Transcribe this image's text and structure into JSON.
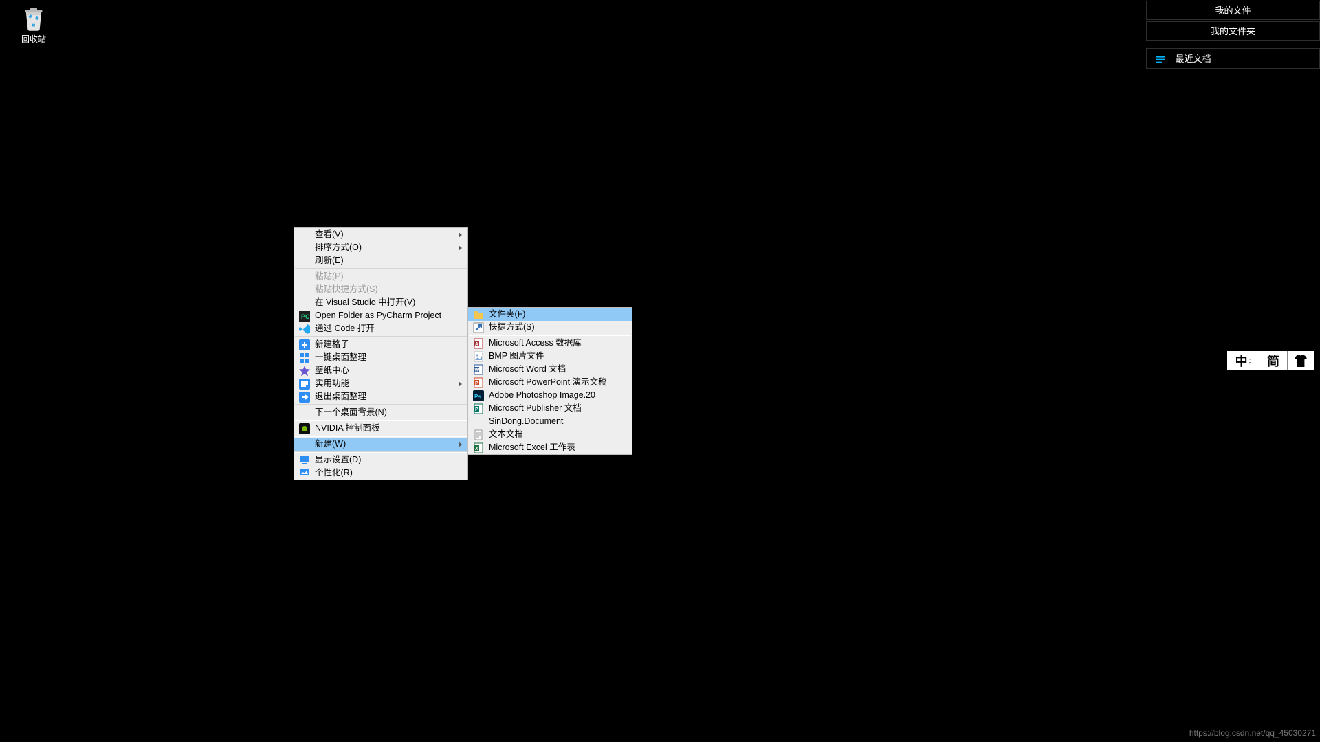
{
  "desktop": {
    "recycle_bin_label": "回收站"
  },
  "side": {
    "my_files": "我的文件",
    "my_folder": "我的文件夹",
    "recent_docs": "最近文档"
  },
  "ctx": {
    "view": "查看(V)",
    "sort": "排序方式(O)",
    "refresh": "刷新(E)",
    "paste": "粘贴(P)",
    "paste_shortcut": "粘贴快捷方式(S)",
    "open_vs": "在 Visual Studio 中打开(V)",
    "open_pycharm": "Open Folder as PyCharm Project",
    "open_code": "通过 Code 打开",
    "new_grid": "新建格子",
    "one_click_arrange": "一键桌面整理",
    "wallpaper_center": "壁纸中心",
    "utility": "实用功能",
    "exit_arrange": "退出桌面整理",
    "next_wallpaper": "下一个桌面背景(N)",
    "nvidia_cp": "NVIDIA 控制面板",
    "new": "新建(W)",
    "display_settings": "显示设置(D)",
    "personalize": "个性化(R)"
  },
  "newmenu": {
    "folder": "文件夹(F)",
    "shortcut": "快捷方式(S)",
    "access": "Microsoft Access 数据库",
    "bmp": "BMP 图片文件",
    "word": "Microsoft Word 文档",
    "ppt": "Microsoft PowerPoint 演示文稿",
    "psd": "Adobe Photoshop Image.20",
    "publisher": "Microsoft Publisher 文档",
    "sindong": "SinDong.Document",
    "txt": "文本文档",
    "excel": "Microsoft Excel 工作表"
  },
  "ime": {
    "s1": "中",
    "s2": "简"
  },
  "watermark": "https://blog.csdn.net/qq_45030271"
}
